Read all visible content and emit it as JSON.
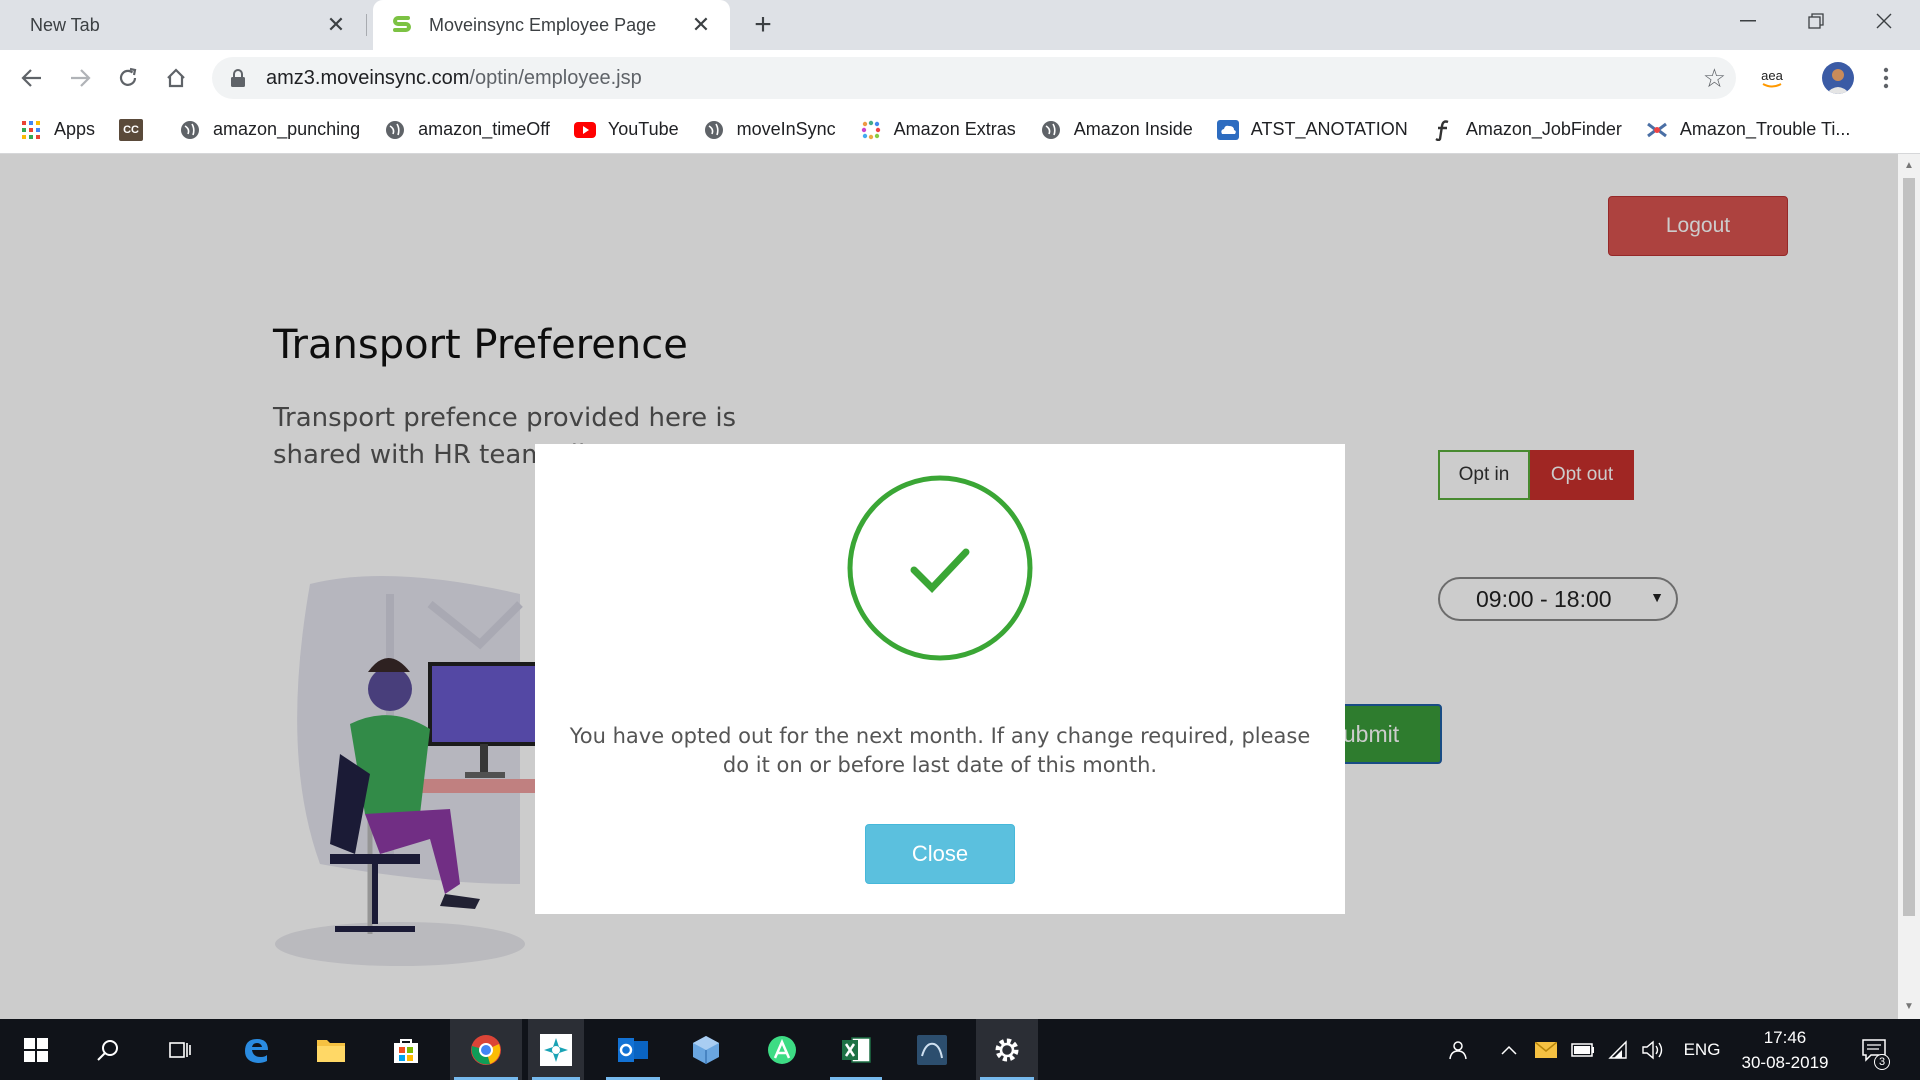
{
  "browser": {
    "tabs": [
      {
        "title": "New Tab"
      },
      {
        "title": "Moveinsync Employee Page"
      }
    ],
    "new_tab_symbol": "+",
    "url_host": "amz3.moveinsync.com",
    "url_path": "/optin/employee.jsp",
    "profile_label": "aea"
  },
  "bookmarks": [
    {
      "label": "Apps",
      "icon": "apps-grid-icon"
    },
    {
      "label": "",
      "icon": "cc-icon"
    },
    {
      "label": "amazon_punching",
      "icon": "globe-icon"
    },
    {
      "label": "amazon_timeOff",
      "icon": "globe-icon"
    },
    {
      "label": "YouTube",
      "icon": "youtube-icon"
    },
    {
      "label": "moveInSync",
      "icon": "globe-icon"
    },
    {
      "label": "Amazon Extras",
      "icon": "dots-icon"
    },
    {
      "label": "Amazon Inside",
      "icon": "globe-icon"
    },
    {
      "label": "ATST_ANOTATION",
      "icon": "cloud-icon"
    },
    {
      "label": "Amazon_JobFinder",
      "icon": "f-icon"
    },
    {
      "label": "Amazon_Trouble Ti...",
      "icon": "puzzle-icon"
    }
  ],
  "page": {
    "logout_label": "Logout",
    "title": "Transport Preference",
    "description": "Transport prefence provided here is shared with HR team allowances",
    "opt_in_label": "Opt in",
    "opt_out_label": "Opt out",
    "shift_value": "09:00 - 18:00",
    "submit_label": "ubmit"
  },
  "modal": {
    "message": "You have opted out for the next month. If any change required, please do it on or before last date of this month.",
    "close_label": "Close"
  },
  "taskbar": {
    "language": "ENG",
    "time": "17:46",
    "date": "30-08-2019",
    "notification_count": "3"
  },
  "colors": {
    "logout": "#d9534f",
    "opt_out": "#c9302c",
    "opt_in_border": "#5aad3c",
    "success_check": "#3aa635",
    "close_button": "#5bc0de",
    "submit": "#3a9b3a"
  }
}
